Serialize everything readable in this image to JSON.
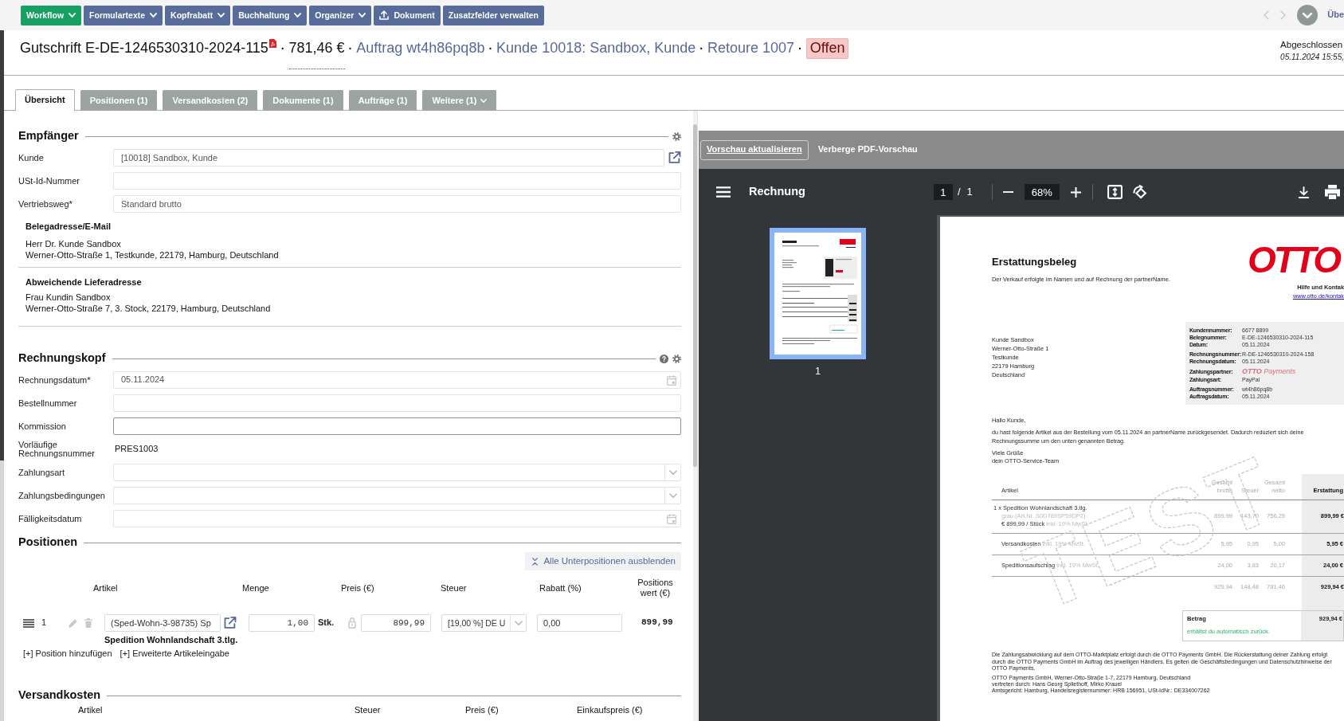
{
  "toolbar": {
    "buttons": [
      {
        "label": "Workflow",
        "kind": "dropdown",
        "primary": true
      },
      {
        "label": "Formulartexte",
        "kind": "dropdown",
        "primary": false
      },
      {
        "label": "Kopfrabatt",
        "kind": "dropdown",
        "primary": false
      },
      {
        "label": "Buchhaltung",
        "kind": "dropdown",
        "primary": false
      },
      {
        "label": "Organizer",
        "kind": "dropdown",
        "primary": false
      },
      {
        "label": "Dokument",
        "kind": "upload",
        "primary": false
      },
      {
        "label": "Zusatzfelder verwalten",
        "kind": "plain",
        "primary": false
      }
    ],
    "next_label": "Übe"
  },
  "title": {
    "heading": "Gutschrift E-DE-1246530310-2024-115",
    "parts": [
      {
        "kind": "separator",
        "text": "·"
      },
      {
        "kind": "amount",
        "text": "781,46 €"
      },
      {
        "kind": "separator",
        "text": "·"
      },
      {
        "kind": "link",
        "text": "Auftrag wt4h86pq8b"
      },
      {
        "kind": "separator",
        "text": "·"
      },
      {
        "kind": "link",
        "text": "Kunde 10018: Sandbox, Kunde"
      },
      {
        "kind": "separator",
        "text": "·"
      },
      {
        "kind": "link",
        "text": "Retoure 1007"
      },
      {
        "kind": "separator",
        "text": "·"
      },
      {
        "kind": "badge",
        "text": "Offen"
      }
    ]
  },
  "status_info": {
    "label": "Abgeschlossen",
    "detail": "05.11.2024 15:55,"
  },
  "tabs": [
    {
      "label": "Übersicht",
      "selected": true,
      "dropdown": false
    },
    {
      "label": "Positionen (1)",
      "selected": false,
      "dropdown": false
    },
    {
      "label": "Versandkosten (2)",
      "selected": false,
      "dropdown": false
    },
    {
      "label": "Dokumente (1)",
      "selected": false,
      "dropdown": false
    },
    {
      "label": "Aufträge (1)",
      "selected": false,
      "dropdown": false
    },
    {
      "label": "Weitere (1)",
      "selected": false,
      "dropdown": true
    }
  ],
  "recipient": {
    "title": "Empfänger",
    "fields": [
      {
        "label": "Kunde",
        "kind": "link",
        "value": "[10018] Sandbox, Kunde"
      },
      {
        "label": "USt-Id-Nummer",
        "kind": "text"
      },
      {
        "label": "Vertriebsweg*",
        "kind": "text",
        "value": "Standard brutto"
      }
    ],
    "addresses": [
      {
        "title": "Belegadresse/E-Mail",
        "lines": [
          "Herr Dr. Kunde Sandbox",
          "Werner-Otto-Straße 1, Testkunde, 22179, Hamburg, Deutschland"
        ]
      },
      {
        "title": "Abweichende Lieferadresse",
        "lines": [
          "Frau Kundin Sandbox",
          "Werner-Otto-Straße 7, 3. Stock, 22179, Hamburg, Deutschland"
        ]
      }
    ]
  },
  "invoice_header": {
    "title": "Rechnungskopf",
    "fields": [
      {
        "label": "Rechnungsdatum*",
        "kind": "date",
        "value": "05.11.2024",
        "focused": false
      },
      {
        "label": "Bestellnummer",
        "kind": "text",
        "focused": false
      },
      {
        "label": "Kommission",
        "kind": "text",
        "focused": true
      },
      {
        "label": "Vorläufige Rechnungsnummer",
        "kind": "static",
        "value": "PRES1003",
        "focused": false
      },
      {
        "label": "Zahlungsart",
        "kind": "select",
        "focused": false
      },
      {
        "label": "Zahlungsbedingungen",
        "kind": "select",
        "focused": false
      },
      {
        "label": "Fälligkeitsdatum",
        "kind": "date",
        "focused": false
      }
    ]
  },
  "positions": {
    "title": "Positionen",
    "collapse_button": "Alle Unterpositionen ausblenden",
    "columns": [
      "Artikel",
      "Menge",
      "Preis (€)",
      "Steuer",
      "Rabatt (%)",
      "Positions wert (€)"
    ],
    "rows": [
      {
        "number": "1",
        "article": "(Sped-Wohn-3-98735) Sp",
        "quantity": "1,00",
        "unit": "Stk.",
        "price": "899,99",
        "tax": "[19,00 %] DE U",
        "discount": "0,00",
        "total": "899,99",
        "name": "Spedition Wohnlandschaft 3.tlg."
      }
    ],
    "actions": [
      "[+] Position hinzufügen",
      "[+] Erweiterte Artikeleingabe"
    ]
  },
  "shipping": {
    "title": "Versandkosten",
    "columns": [
      "Artikel",
      "Steuer",
      "Preis (€)",
      "Einkaufspreis (€)"
    ]
  },
  "preview": {
    "buttons": [
      {
        "label": "Vorschau aktualisieren",
        "kind": "outline"
      },
      {
        "label": "Verberge PDF-Vorschau",
        "kind": "plain"
      }
    ],
    "viewer": {
      "title": "Rechnung",
      "page": "1",
      "page_separator": "/",
      "page_count": "1",
      "zoom": "68%",
      "thumbnails": [
        {
          "label": "1",
          "selected": true
        }
      ]
    },
    "document": {
      "title": "Erstattungsbeleg",
      "subtitle": "Der Verkauf erfolgte im Namen und auf Rechnung der partnerName.",
      "logo": "OTTO",
      "contact_title": "Hilfe und Kontak",
      "contact_link": "www.otto.de/kontak",
      "address": [
        "Kunde Sandbox",
        "Werner-Otto-Straße 1",
        "Testkunde",
        "22179 Hamburg",
        "Deutschland"
      ],
      "info": [
        [
          {
            "label": "Kundennummer:",
            "value": "6677 8899",
            "kind": "text"
          },
          {
            "label": "Belegnummer:",
            "value": "E-DE-1246530310-2024-115",
            "kind": "text"
          },
          {
            "label": "Datum:",
            "value": "05.11.2024",
            "kind": "text"
          }
        ],
        [
          {
            "label": "Rechnungsnummer:",
            "value": "R-DE-1246530310-2024-158",
            "kind": "text"
          },
          {
            "label": "Rechnungsdatum:",
            "value": "05.11.2024",
            "kind": "text"
          }
        ],
        [
          {
            "label": "Zahlungspartner:",
            "value": "**OTTO** Payments",
            "kind": "logo"
          },
          {
            "label": "Zahlungsart:",
            "value": "PayPal",
            "kind": "text"
          }
        ],
        [
          {
            "label": "Auftragsnummer:",
            "value": "wt4h86pq8b",
            "kind": "text"
          },
          {
            "label": "Auftragsdatum:",
            "value": "05.11.2024",
            "kind": "text"
          }
        ]
      ],
      "greeting": "Hallo Kunde,",
      "body": "du hast folgende Artikel aus der Bestellung vom 05.11.2024 an partnerName zurückgesendet. Dadurch reduziert sich deine Rechnungssumme um den unten genannten Betrag.",
      "closing": [
        "Viele Grüße",
        "dein OTTO-Service-Team"
      ],
      "table": {
        "columns": [
          "Artikel",
          "Gesamt brutto",
          "Steuer",
          "Gesamt netto",
          "Erstattung"
        ],
        "rows": [
          {
            "kind": "item",
            "title": "1 x Spedition Wohnlandschaft 3.tlg.",
            "variant": "grau (Art.Nr. S0D789SP59DP2)",
            "price": "€ 899,99 / Stück",
            "note": "inkl. 19% MwSt.",
            "values": [
              "899,99",
              "143,70",
              "756,29"
            ],
            "refund": "899,99 €"
          },
          {
            "kind": "fee",
            "title": "Versandkosten",
            "note": "inkl. 19% MwSt.",
            "values": [
              "5,95",
              "0,95",
              "5,00"
            ],
            "refund": "5,95 €"
          },
          {
            "kind": "fee",
            "title": "Speditionsaufschlag",
            "note": "inkl. 19% MwSt.",
            "values": [
              "24,00",
              "3,83",
              "20,17"
            ],
            "refund": "24,00 €"
          },
          {
            "kind": "total",
            "values": [
              "929,94",
              "148,48",
              "781,46"
            ],
            "refund": "929,94 €"
          }
        ]
      },
      "total": {
        "label": "Betrag",
        "amount": "929,94 €",
        "note": "erhältst du automatisch zurück."
      },
      "footer": {
        "notice": "Die Zahlungsabwicklung auf dem OTTO-Marktplatz erfolgt durch die OTTO Payments GmbH. Die Rückerstattung deiner Zahlung erfolgt durch die OTTO Payments GmbH im Auftrag des jeweiligen Händlers. Es gelten die Geschäftsbedingungen und Datenschutzhinweise der OTTO Payments.",
        "imprint": [
          "OTTO Payments GmbH, Werner-Otto-Straße 1-7, 22179 Hamburg, Deutschland",
          "vertreten durch: Hans Georg Spliethoff, Mirko Krauel",
          "Amtsgericht: Hamburg, Handelsregisternummer: HRB 156951, USt-IdNr.: DE334007262"
        ]
      },
      "stamp": "TEST"
    }
  }
}
